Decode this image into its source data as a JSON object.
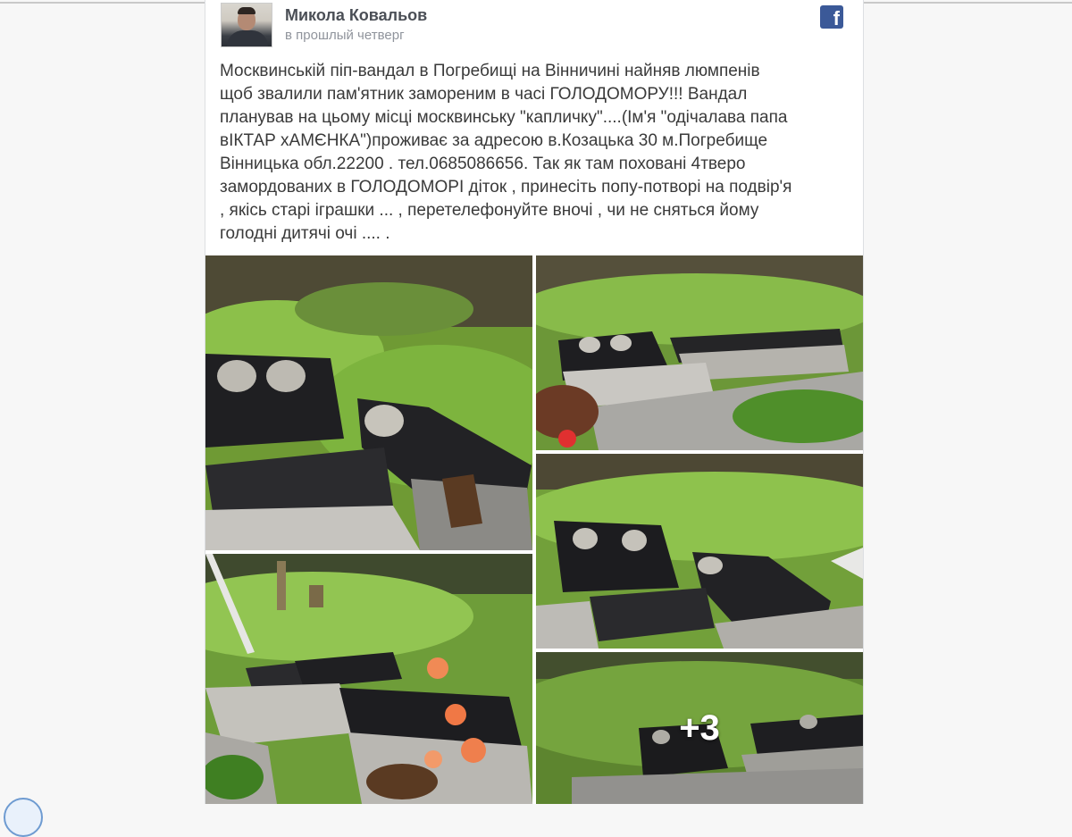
{
  "post": {
    "author": "Микола Ковальов",
    "timestamp": "в прошлый четверг",
    "network_icon": "facebook-icon",
    "text_lines": [
      "Москвинській піп-вандал в Погребищі на Вінничині найняв люмпенів",
      "щоб звалили пам'ятник замореним в часі ГОЛОДОМОРУ!!! Вандал",
      "планував на цьому місці москвинську \"капличку\"....(Ім'я \"одічалава папа",
      "вІКТАР хАМЄНКА\")проживає за адресою в.Козацька 30 м.Погребище",
      "Вінницька обл.22200 . тел.0685086656. Так як там поховані 4твеpo",
      "замордованих в ГОЛОДОМОРІ діток , принесіть попу-потворі на подвір'я",
      ", якісь старі іграшки ... , перетелефонуйте вночі , чи не сняться йому",
      "голодні дитячі очі .... ."
    ],
    "photos": [
      {
        "subject": "toppled-gravestones-photo"
      },
      {
        "subject": "broken-tombstones-photo"
      },
      {
        "subject": "damaged-memorial-slabs-photo"
      },
      {
        "subject": "fallen-gravestones-with-flowers-photo"
      },
      {
        "subject": "gravestones-in-grass-photo",
        "more_label": "+3"
      }
    ]
  }
}
